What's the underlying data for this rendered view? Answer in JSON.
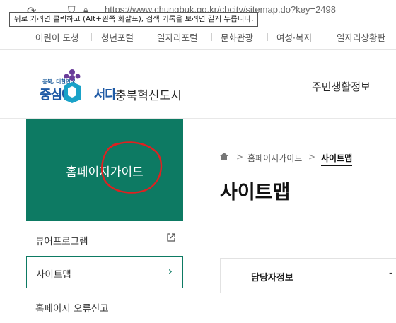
{
  "browser": {
    "url": "https://www.chungbuk.go.kr/cbcity/sitemap.do?key=2498",
    "back_tooltip": "뒤로 가려면 클릭하고 (Alt+왼쪽 화살표), 검색 기록을 보려면 길게 누릅니다."
  },
  "topnav": {
    "items": [
      "어린이 도청",
      "청년포털",
      "일자리포털",
      "문화관광",
      "여성·복지",
      "일자리상황판"
    ]
  },
  "header": {
    "logo_small": "충북, 대한민국",
    "logo_main_left": "중심에",
    "logo_main_right": "서다",
    "logo_name": "충북혁신도시",
    "menu_item": "주민생활정보"
  },
  "sidebar": {
    "hero_title": "홈페이지가이드",
    "items": [
      {
        "label": "뷰어프로그램"
      },
      {
        "label": "사이트맵"
      },
      {
        "label": "홈페이지 오류신고"
      }
    ]
  },
  "breadcrumb": {
    "sep": ">",
    "items": [
      "홈페이지가이드",
      "사이트맵"
    ]
  },
  "main": {
    "title": "사이트맵",
    "info_label": "담당자정보",
    "info_dash": "-"
  },
  "colors": {
    "accent_green": "#0d7a63",
    "logo_blue": "#1f5aa5",
    "logo_purple": "#6a3d9a",
    "annotation_red": "#e02020"
  }
}
